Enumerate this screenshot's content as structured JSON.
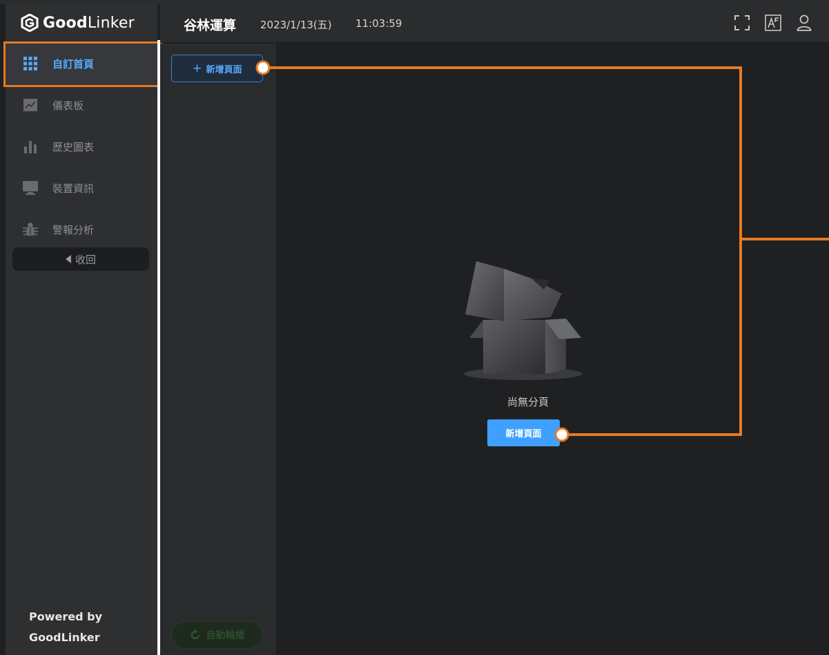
{
  "brand": {
    "logo_bold": "Good",
    "logo_light": "Linker",
    "powered_line1": "Powered by",
    "powered_line2": "GoodLinker"
  },
  "header": {
    "title": "谷林運算",
    "date": "2023/1/13(五)",
    "time": "11:03:59",
    "icons": [
      "fullscreen-icon",
      "font-size-icon",
      "user-icon"
    ]
  },
  "sidebar": {
    "items": [
      {
        "label": "自訂首頁",
        "icon": "grid-icon",
        "active": true
      },
      {
        "label": "儀表板",
        "icon": "line-chart-icon",
        "active": false
      },
      {
        "label": "歷史圖表",
        "icon": "bar-chart-icon",
        "active": false
      },
      {
        "label": "裝置資訊",
        "icon": "monitor-icon",
        "active": false
      },
      {
        "label": "警報分析",
        "icon": "bug-icon",
        "active": false
      }
    ],
    "collapse_label": "收回"
  },
  "pagelist": {
    "add_label": "新增頁面",
    "autoplay_label": "自動輪播"
  },
  "empty_state": {
    "message": "尚無分頁",
    "add_label": "新增頁面"
  },
  "colors": {
    "accent_blue": "#40a0ff",
    "annotation_orange": "#e67a23",
    "sidebar_bg": "#2e2f31",
    "main_bg": "#1f2022"
  }
}
